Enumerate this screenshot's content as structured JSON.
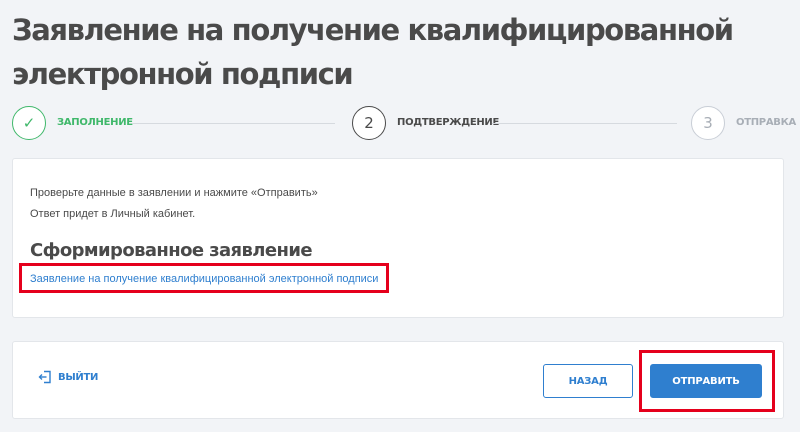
{
  "page": {
    "title": "Заявление на получение квалифицированной электронной подписи"
  },
  "stepper": {
    "steps": [
      {
        "number": "✓",
        "label": "Заполнение",
        "state": "done"
      },
      {
        "number": "2",
        "label": "Подтверждение",
        "state": "active"
      },
      {
        "number": "3",
        "label": "Отправка",
        "state": "pending"
      }
    ]
  },
  "info": {
    "line1": "Проверьте данные в заявлении и нажмите «Отправить»",
    "line2": "Ответ придет в Личный кабинет.",
    "section_title": "Сформированное заявление",
    "document_link": "Заявление на получение квалифицированной электронной подписи"
  },
  "actions": {
    "exit_label": "Выйти",
    "back_label": "Назад",
    "send_label": "Отправить"
  },
  "colors": {
    "accent": "#2f7fcf",
    "success": "#40b86b",
    "highlight": "#e5001c",
    "text": "#4a4a4a",
    "muted": "#a8aeb6"
  },
  "icons": {
    "done_step": "check-icon",
    "exit": "logout-icon"
  }
}
